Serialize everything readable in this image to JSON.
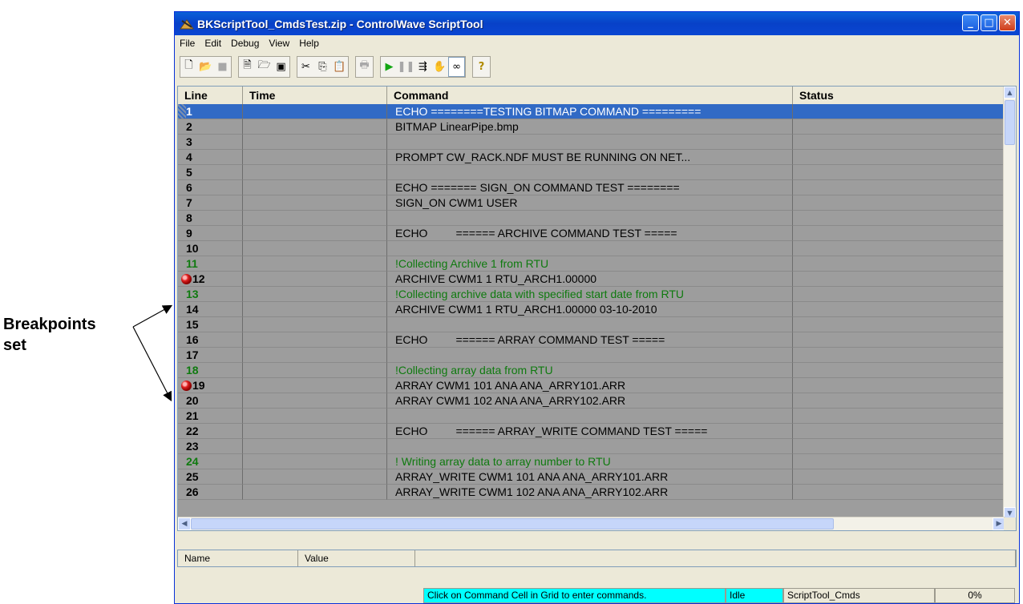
{
  "annotation": {
    "label_line1": "Breakpoints",
    "label_line2": "set"
  },
  "window": {
    "title": "BKScriptTool_CmdsTest.zip - ControlWave ScriptTool",
    "controls": [
      "minimize",
      "maximize",
      "close"
    ]
  },
  "menu": [
    "File",
    "Edit",
    "Debug",
    "View",
    "Help"
  ],
  "toolbar": {
    "groups": [
      [
        "new-icon",
        "open-icon",
        "save-icon"
      ],
      [
        "properties-icon",
        "open-folder-icon",
        "save-disk-icon"
      ],
      [
        "cut-icon",
        "copy-icon",
        "paste-icon"
      ],
      [
        "print-icon"
      ],
      [
        "run-icon",
        "pause-icon",
        "step-icon",
        "stop-hand-icon",
        "watch-glasses-icon"
      ],
      [
        "help-icon"
      ]
    ]
  },
  "grid": {
    "columns": [
      "Line",
      "Time",
      "Command",
      "Status"
    ],
    "rows": [
      {
        "line": "1",
        "time": "",
        "command": "ECHO ========TESTING BITMAP COMMAND =========",
        "status": "",
        "selected": true
      },
      {
        "line": "2",
        "time": "",
        "command": "BITMAP LinearPipe.bmp",
        "status": ""
      },
      {
        "line": "3",
        "time": "",
        "command": "",
        "status": ""
      },
      {
        "line": "4",
        "time": "",
        "command": "PROMPT CW_RACK.NDF MUST BE RUNNING ON NET...",
        "status": ""
      },
      {
        "line": "5",
        "time": "",
        "command": "",
        "status": ""
      },
      {
        "line": "6",
        "time": "",
        "command": "ECHO ======= SIGN_ON COMMAND TEST ========",
        "status": ""
      },
      {
        "line": "7",
        "time": "",
        "command": "SIGN_ON CWM1 USER",
        "status": ""
      },
      {
        "line": "8",
        "time": "",
        "command": "",
        "status": ""
      },
      {
        "line": "9",
        "time": "",
        "command": "ECHO         ====== ARCHIVE COMMAND TEST =====",
        "status": ""
      },
      {
        "line": "10",
        "time": "",
        "command": "",
        "status": ""
      },
      {
        "line": "11",
        "time": "",
        "command": "!Collecting Archive 1 from RTU",
        "status": "",
        "comment": true
      },
      {
        "line": "12",
        "time": "",
        "command": "ARCHIVE CWM1 1 RTU_ARCH1.00000",
        "status": "",
        "breakpoint": true
      },
      {
        "line": "13",
        "time": "",
        "command": "!Collecting archive data with specified start date from RTU",
        "status": "",
        "comment": true
      },
      {
        "line": "14",
        "time": "",
        "command": "ARCHIVE CWM1 1 RTU_ARCH1.00000 03-10-2010",
        "status": ""
      },
      {
        "line": "15",
        "time": "",
        "command": "",
        "status": ""
      },
      {
        "line": "16",
        "time": "",
        "command": "ECHO         ====== ARRAY COMMAND TEST =====",
        "status": ""
      },
      {
        "line": "17",
        "time": "",
        "command": "",
        "status": ""
      },
      {
        "line": "18",
        "time": "",
        "command": "!Collecting array data from RTU",
        "status": "",
        "comment": true
      },
      {
        "line": "19",
        "time": "",
        "command": "ARRAY CWM1 101 ANA ANA_ARRY101.ARR",
        "status": "",
        "breakpoint": true
      },
      {
        "line": "20",
        "time": "",
        "command": "ARRAY CWM1 102 ANA ANA_ARRY102.ARR",
        "status": ""
      },
      {
        "line": "21",
        "time": "",
        "command": "",
        "status": ""
      },
      {
        "line": "22",
        "time": "",
        "command": "ECHO         ====== ARRAY_WRITE COMMAND TEST =====",
        "status": ""
      },
      {
        "line": "23",
        "time": "",
        "command": "",
        "status": ""
      },
      {
        "line": "24",
        "time": "",
        "command": "! Writing array data to array number to RTU",
        "status": "",
        "comment": true
      },
      {
        "line": "25",
        "time": "",
        "command": "ARRAY_WRITE CWM1 101 ANA ANA_ARRY101.ARR",
        "status": ""
      },
      {
        "line": "26",
        "time": "",
        "command": "ARRAY_WRITE CWM1 102 ANA ANA_ARRY102.ARR",
        "status": ""
      }
    ]
  },
  "variables": {
    "columns": [
      "Name",
      "Value"
    ]
  },
  "statusbar": {
    "hint": "Click on Command Cell in Grid to enter commands.",
    "state": "Idle",
    "script": "ScriptTool_Cmds",
    "progress": "0%",
    "hint_color": "#00ffff",
    "state_color": "#00ffff"
  },
  "colors": {
    "selection": "#316ac5",
    "comment": "#0f7a0f",
    "grid_bg": "#9d9d9d"
  }
}
